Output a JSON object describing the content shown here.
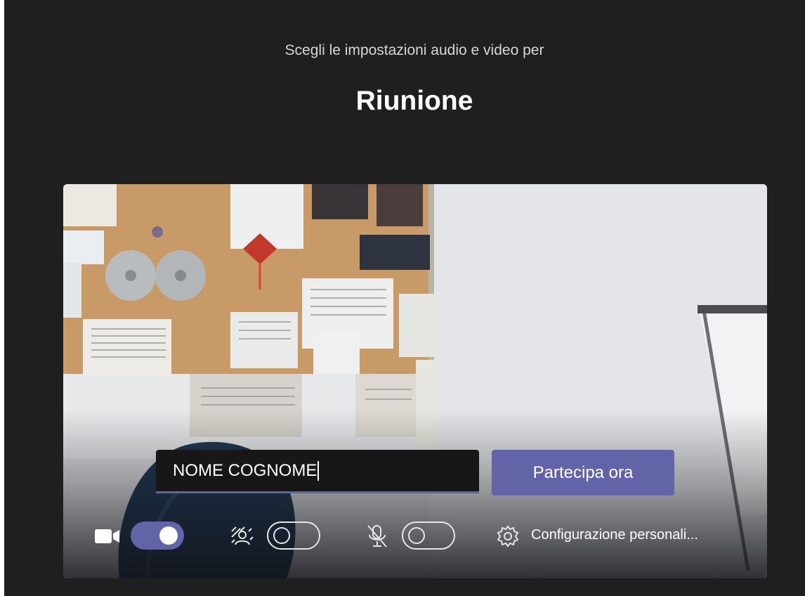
{
  "header": {
    "subtitle": "Scegli le impostazioni audio e video per",
    "title": "Riunione"
  },
  "join_form": {
    "name_value": "NOME COGNOME",
    "join_label": "Partecipa ora"
  },
  "controls": {
    "camera": {
      "icon": "camera-icon",
      "toggle_on": true
    },
    "background_blur": {
      "icon": "background-blur-icon",
      "toggle_on": false
    },
    "microphone": {
      "icon": "mic-off-icon",
      "toggle_on": false
    },
    "settings": {
      "icon": "gear-icon",
      "label": "Configurazione personali..."
    }
  },
  "colors": {
    "background": "#201f1f",
    "accent": "#6264a7",
    "input_bg": "#171717"
  }
}
